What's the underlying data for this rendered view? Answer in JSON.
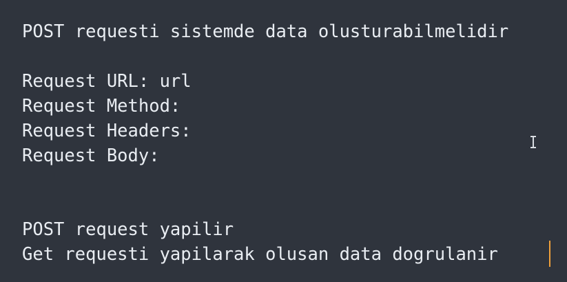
{
  "editor": {
    "lines": [
      "POST requesti sistemde data olusturabilmelidir",
      "Request URL: url",
      "Request Method:",
      "Request Headers:",
      "Request Body:",
      "POST request yapilir",
      "Get requesti yapilarak olusan data dogrulanir"
    ],
    "background_color": "#2f343d",
    "text_color": "#e9edf2",
    "caret_color": "#f0a13b",
    "pointer_icon": "text-cursor-icon"
  }
}
